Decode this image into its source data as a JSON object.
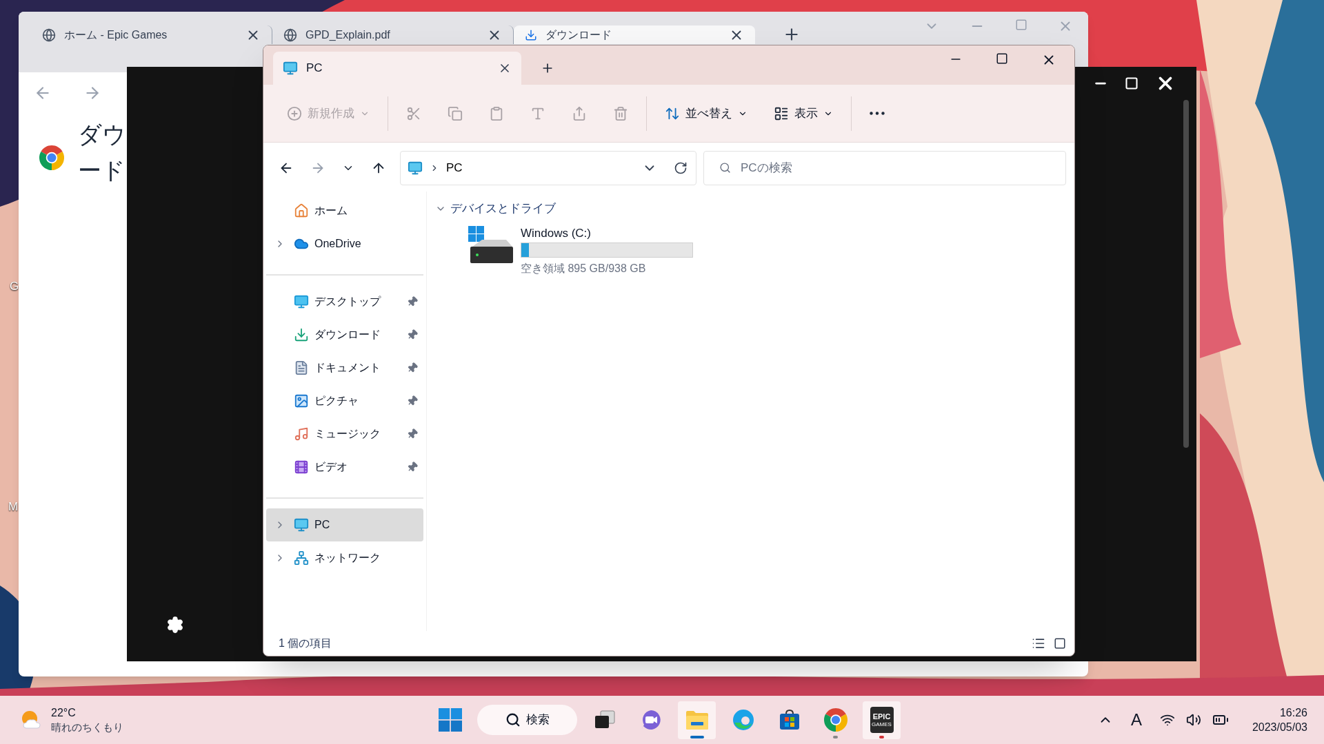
{
  "desktop": {
    "icon_labels": [
      "G",
      "M"
    ]
  },
  "browser": {
    "tabs": [
      {
        "title": "ホーム - Epic Games",
        "kind": "globe",
        "selected": false
      },
      {
        "title": "GPD_Explain.pdf",
        "kind": "globe",
        "selected": false
      },
      {
        "title": "ダウンロード",
        "kind": "download",
        "selected": true
      }
    ],
    "heading_lines": [
      "ダウ",
      "ード"
    ]
  },
  "explorer": {
    "tabs": [
      {
        "title": "PC",
        "selected": true
      }
    ],
    "toolbar_groups": [
      {
        "items": [
          {
            "kind": "new",
            "label": "新規作成",
            "disabled": true
          }
        ]
      },
      {
        "items": [
          {
            "kind": "cut",
            "disabled": true
          },
          {
            "kind": "copy",
            "disabled": true
          },
          {
            "kind": "paste",
            "disabled": true
          },
          {
            "kind": "rename",
            "disabled": true
          },
          {
            "kind": "share",
            "disabled": true
          },
          {
            "kind": "delete",
            "disabled": true
          }
        ]
      },
      {
        "items": [
          {
            "kind": "sort",
            "label": "並べ替え",
            "disabled": false
          },
          {
            "kind": "view",
            "label": "表示",
            "disabled": false
          }
        ]
      },
      {
        "items": [
          {
            "kind": "more",
            "disabled": false
          }
        ]
      }
    ],
    "address": {
      "path": "PC"
    },
    "search": {
      "placeholder": "PCの検索"
    },
    "nav_sections": [
      {
        "items": [
          {
            "kind": "home",
            "label": "ホーム",
            "expandable": false,
            "pinned": false,
            "selected": false
          },
          {
            "kind": "onedrive",
            "label": "OneDrive",
            "expandable": true,
            "pinned": false,
            "selected": false
          }
        ]
      },
      {
        "items": [
          {
            "kind": "desktop",
            "label": "デスクトップ",
            "expandable": false,
            "pinned": true,
            "selected": false
          },
          {
            "kind": "downloads",
            "label": "ダウンロード",
            "expandable": false,
            "pinned": true,
            "selected": false
          },
          {
            "kind": "documents",
            "label": "ドキュメント",
            "expandable": false,
            "pinned": true,
            "selected": false
          },
          {
            "kind": "pictures",
            "label": "ピクチャ",
            "expandable": false,
            "pinned": true,
            "selected": false
          },
          {
            "kind": "music",
            "label": "ミュージック",
            "expandable": false,
            "pinned": true,
            "selected": false
          },
          {
            "kind": "videos",
            "label": "ビデオ",
            "expandable": false,
            "pinned": true,
            "selected": false
          }
        ]
      },
      {
        "items": [
          {
            "kind": "pc",
            "label": "PC",
            "expandable": true,
            "pinned": false,
            "selected": true
          },
          {
            "kind": "network",
            "label": "ネットワーク",
            "expandable": true,
            "pinned": false,
            "selected": false
          }
        ]
      }
    ],
    "section": {
      "title": "デバイスとドライブ",
      "expanded": true
    },
    "drives": [
      {
        "name": "Windows (C:)",
        "level": 0.046,
        "free": "空き領域 895 GB/938 GB"
      }
    ],
    "status": "1 個の項目"
  },
  "taskbar": {
    "weather": {
      "temperature": "22°C",
      "condition": "晴れのちくもり"
    },
    "search_label": "検索",
    "apps": [
      {
        "kind": "taskview",
        "running": false,
        "focused": false,
        "attention": false
      },
      {
        "kind": "meet",
        "running": false,
        "focused": false,
        "attention": false
      },
      {
        "kind": "explorer",
        "running": true,
        "focused": true,
        "attention": false
      },
      {
        "kind": "edge",
        "running": false,
        "focused": false,
        "attention": false
      },
      {
        "kind": "store",
        "running": false,
        "focused": false,
        "attention": false
      },
      {
        "kind": "chrome",
        "running": true,
        "focused": false,
        "attention": false
      },
      {
        "kind": "epic",
        "running": true,
        "focused": false,
        "attention": true,
        "logo_text": "EPIC",
        "logo_subtext": "GAMES"
      }
    ],
    "ime": "A",
    "time": "16:26",
    "date": "2023/05/03"
  }
}
